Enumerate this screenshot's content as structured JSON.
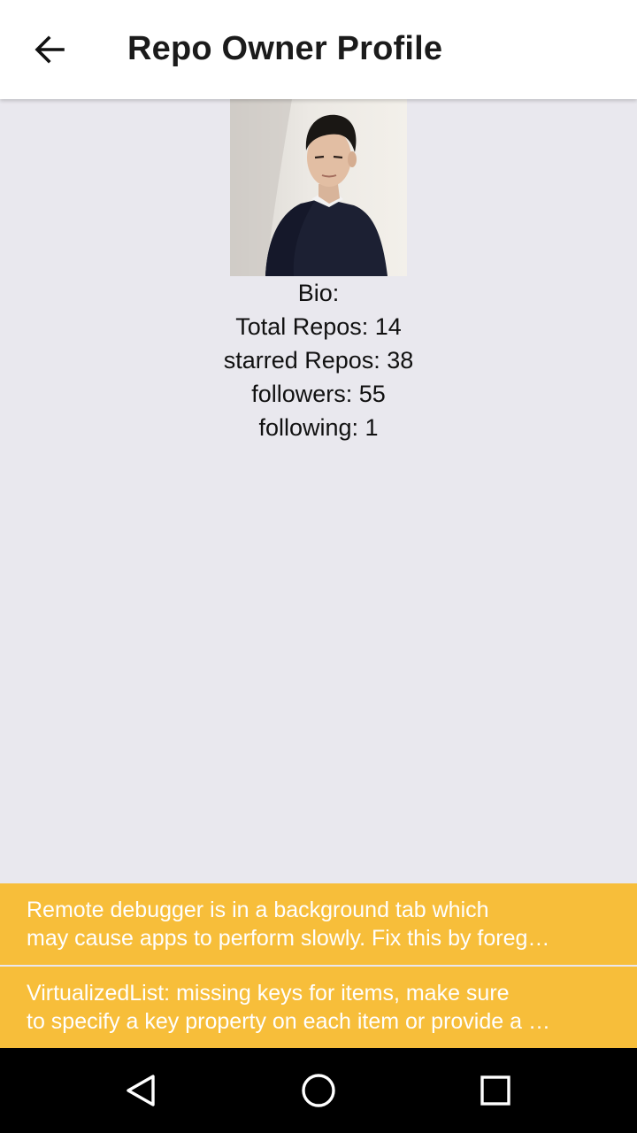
{
  "header": {
    "title": "Repo Owner Profile",
    "back_icon": "arrow-left-icon"
  },
  "profile": {
    "avatar_alt": "profile photo",
    "bio": "Bio:",
    "total_repos": "Total Repos: 14",
    "starred_repos": "starred Repos: 38",
    "followers": "followers: 55",
    "following": "following: 1"
  },
  "warnings": [
    {
      "line1": "Remote debugger is in a background tab which",
      "line2": "may cause apps to perform slowly. Fix this by foreg…"
    },
    {
      "line1": "VirtualizedList: missing keys for items, make sure",
      "line2": "to specify a key property on each item or provide a …"
    }
  ],
  "navbar": {
    "back_icon": "triangle-back-icon",
    "home_icon": "circle-home-icon",
    "recents_icon": "square-recents-icon"
  },
  "colors": {
    "background": "#e9e8ee",
    "warning": "#f7be3a",
    "navbar": "#000000"
  }
}
